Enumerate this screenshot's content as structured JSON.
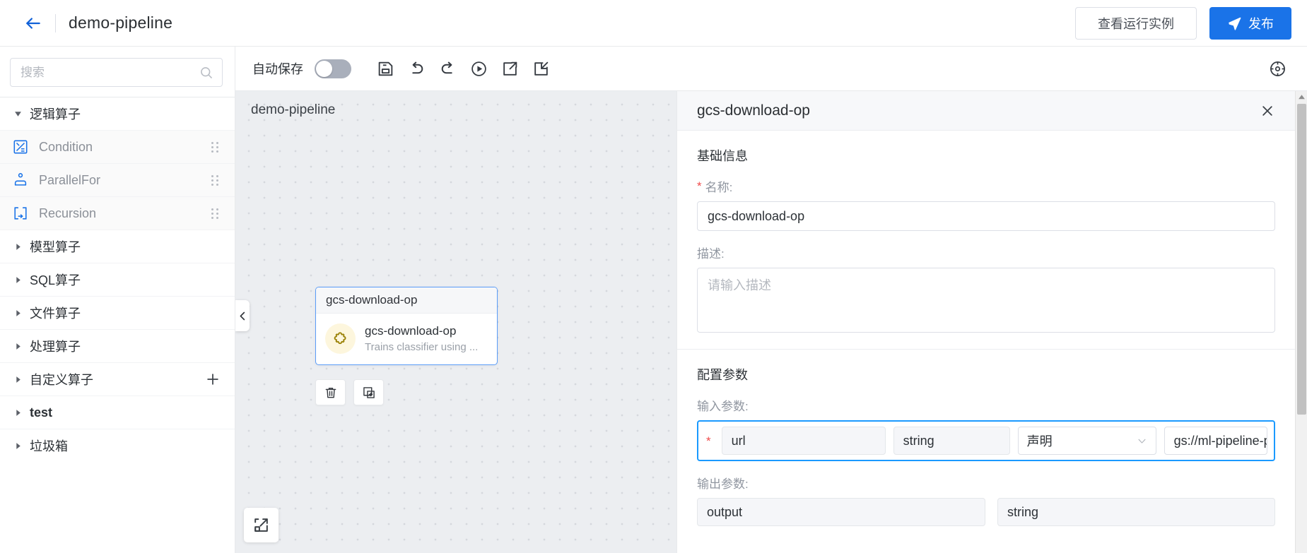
{
  "header": {
    "back_icon": "arrow-left-icon",
    "title": "demo-pipeline",
    "view_runs_label": "查看运行实例",
    "publish_label": "发布",
    "publish_icon": "send-icon",
    "primary_color": "#1a73e8"
  },
  "sidebar": {
    "search": {
      "placeholder": "搜索",
      "value": "",
      "icon": "search-icon"
    },
    "groups": [
      {
        "label": "逻辑算子",
        "expanded": true
      },
      {
        "label": "模型算子",
        "expanded": false
      },
      {
        "label": "SQL算子",
        "expanded": false
      },
      {
        "label": "文件算子",
        "expanded": false
      },
      {
        "label": "处理算子",
        "expanded": false
      },
      {
        "label": "自定义算子",
        "expanded": false,
        "action": "+"
      },
      {
        "label": "test",
        "expanded": false,
        "bold": true
      },
      {
        "label": "垃圾箱",
        "expanded": false
      }
    ],
    "logic_items": [
      {
        "label": "Condition",
        "icon": "condition-icon"
      },
      {
        "label": "ParallelFor",
        "icon": "parallel-for-icon"
      },
      {
        "label": "Recursion",
        "icon": "recursion-icon"
      }
    ]
  },
  "toolbar": {
    "autosave_label": "自动保存",
    "autosave_on": false,
    "icons": [
      {
        "name": "save-icon"
      },
      {
        "name": "undo-icon"
      },
      {
        "name": "redo-icon"
      },
      {
        "name": "run-icon"
      },
      {
        "name": "export-icon"
      },
      {
        "name": "import-icon"
      }
    ],
    "settings_icon": "settings-icon"
  },
  "canvas": {
    "title": "demo-pipeline",
    "collapse_icon": "chevron-left-icon",
    "fit_icon": "fit-screen-icon",
    "node": {
      "header": "gcs-download-op",
      "name": "gcs-download-op",
      "description": "Trains classifier using ...",
      "icon": "puzzle-icon",
      "icon_bg": "#fdf6dd",
      "border_color": "#5a9cf8",
      "tools": [
        {
          "name": "delete-icon"
        },
        {
          "name": "copy-icon"
        }
      ]
    }
  },
  "panel": {
    "title": "gcs-download-op",
    "close_icon": "close-icon",
    "basic": {
      "section_title": "基础信息",
      "name_label": "名称:",
      "name_required": "*",
      "name_value": "gcs-download-op",
      "desc_label": "描述:",
      "desc_value": "",
      "desc_placeholder": "请输入描述"
    },
    "config": {
      "section_title": "配置参数",
      "input_label": "输入参数:",
      "output_label": "输出参数:",
      "input_params": [
        {
          "required": "*",
          "name": "url",
          "type": "string",
          "source": "声明",
          "value": "gs://ml-pipeline-playgro",
          "highlight_color": "#1a9aff"
        }
      ],
      "output_params": [
        {
          "name": "output",
          "type": "string"
        }
      ]
    }
  },
  "scrollbar": {
    "up_icon": "caret-up-icon"
  }
}
